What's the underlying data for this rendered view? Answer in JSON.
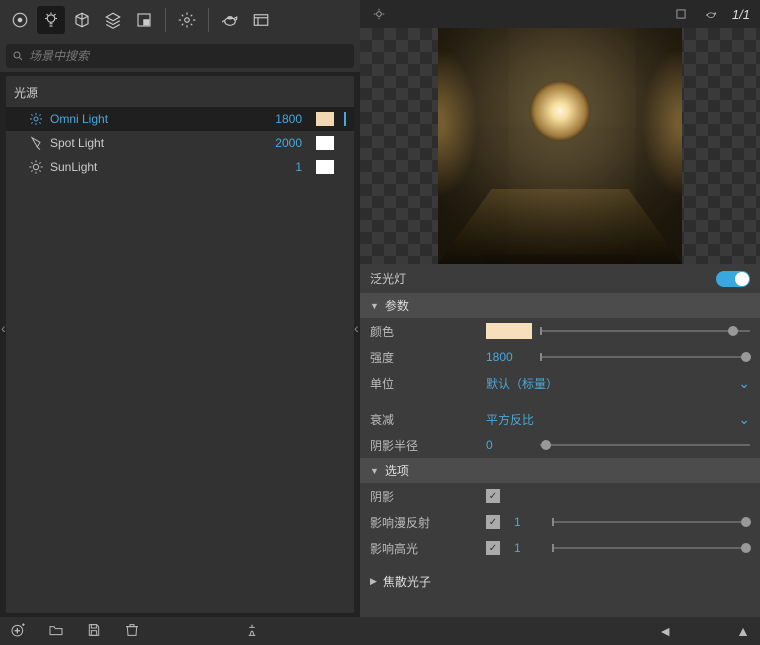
{
  "search": {
    "placeholder": "场景中搜索"
  },
  "scene": {
    "header": "光源",
    "lights": [
      {
        "name": "Omni Light",
        "intensity": "1800",
        "swatch": "#f0d8b2",
        "selected": true
      },
      {
        "name": "Spot Light",
        "intensity": "2000",
        "swatch": "#ffffff",
        "selected": false
      },
      {
        "name": "SunLight",
        "intensity": "1",
        "swatch": "#ffffff",
        "selected": false
      }
    ]
  },
  "viewport": {
    "ratio": "1/1"
  },
  "light_panel": {
    "title": "泛光灯",
    "sections": {
      "params": "参数",
      "options": "选项",
      "caustics": "焦散光子"
    },
    "color_label": "颜色",
    "color_value": "#f6dfba",
    "intensity_label": "强度",
    "intensity_value": "1800",
    "unit_label": "单位",
    "unit_value": "默认（标量）",
    "falloff_label": "衰减",
    "falloff_value": "平方反比",
    "shadow_radius_label": "阴影半径",
    "shadow_radius_value": "0",
    "shadow_label": "阴影",
    "diffuse_label": "影响漫反射",
    "diffuse_value": "1",
    "specular_label": "影响高光",
    "specular_value": "1"
  }
}
